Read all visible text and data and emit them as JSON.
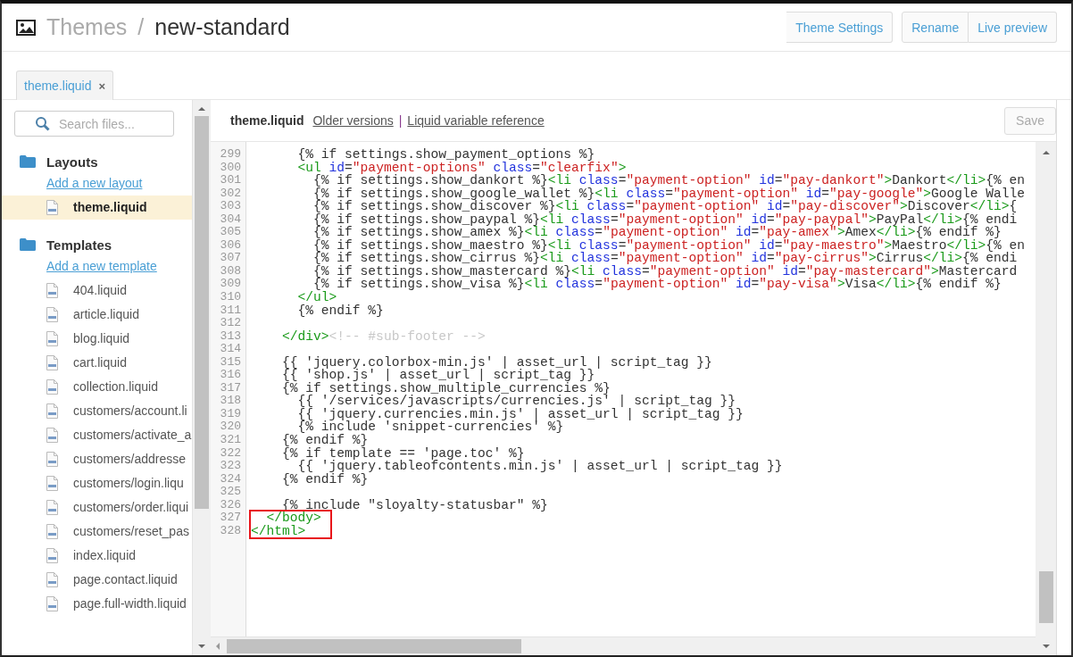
{
  "header": {
    "breadcrumb": "Themes",
    "separator": "/",
    "title": "new-standard",
    "button_groups": [
      {
        "buttons": [
          "Theme Settings"
        ]
      },
      {
        "buttons": [
          "Rename",
          "Live preview"
        ]
      }
    ]
  },
  "tabs": [
    {
      "label": "theme.liquid",
      "close": "×",
      "selected": true
    }
  ],
  "sidebar": {
    "search": {
      "placeholder": "Search files..."
    },
    "sections": [
      {
        "title": "Layouts",
        "add_link": "Add a new layout",
        "items": [
          {
            "label": "theme.liquid",
            "selected": true
          }
        ]
      },
      {
        "title": "Templates",
        "add_link": "Add a new template",
        "items": [
          {
            "label": "404.liquid",
            "selected": false
          },
          {
            "label": "article.liquid",
            "selected": false
          },
          {
            "label": "blog.liquid",
            "selected": false
          },
          {
            "label": "cart.liquid",
            "selected": false
          },
          {
            "label": "collection.liquid",
            "selected": false
          },
          {
            "label": "customers/account.li",
            "selected": false
          },
          {
            "label": "customers/activate_a",
            "selected": false
          },
          {
            "label": "customers/addresse",
            "selected": false
          },
          {
            "label": "customers/login.liqu",
            "selected": false
          },
          {
            "label": "customers/order.liqui",
            "selected": false
          },
          {
            "label": "customers/reset_pas",
            "selected": false
          },
          {
            "label": "index.liquid",
            "selected": false
          },
          {
            "label": "page.contact.liquid",
            "selected": false
          },
          {
            "label": "page.full-width.liquid",
            "selected": false
          }
        ]
      }
    ]
  },
  "editor": {
    "filename": "theme.liquid",
    "links": [
      "Older versions",
      "Liquid variable reference"
    ],
    "link_separator": "|",
    "save": {
      "label": "Save",
      "disabled": true
    },
    "lines": [
      {
        "number": "299",
        "highlighted": false,
        "tokens": [
          {
            "kind": "plain",
            "text": "      {% if settings.show_payment_options %}"
          }
        ]
      },
      {
        "number": "300",
        "highlighted": false,
        "tokens": [
          {
            "kind": "tag",
            "text": "      <ul "
          },
          {
            "kind": "attr",
            "text": "id"
          },
          {
            "kind": "plain",
            "text": "="
          },
          {
            "kind": "string",
            "text": "\"payment-options\" "
          },
          {
            "kind": "attr",
            "text": "class"
          },
          {
            "kind": "plain",
            "text": "="
          },
          {
            "kind": "string",
            "text": "\"clearfix\""
          },
          {
            "kind": "tag",
            "text": ">"
          }
        ]
      },
      {
        "number": "301",
        "highlighted": false,
        "tokens": [
          {
            "kind": "plain",
            "text": "        {% if settings.show_dankort %}"
          },
          {
            "kind": "tag",
            "text": "<li "
          },
          {
            "kind": "attr",
            "text": "class"
          },
          {
            "kind": "plain",
            "text": "="
          },
          {
            "kind": "string",
            "text": "\"payment-option\" "
          },
          {
            "kind": "attr",
            "text": "id"
          },
          {
            "kind": "plain",
            "text": "="
          },
          {
            "kind": "string",
            "text": "\"pay-dankort\""
          },
          {
            "kind": "tag",
            "text": ">"
          },
          {
            "kind": "plain",
            "text": "Dankort"
          },
          {
            "kind": "tag",
            "text": "</li>"
          },
          {
            "kind": "plain",
            "text": "{% en"
          }
        ]
      },
      {
        "number": "302",
        "highlighted": false,
        "tokens": [
          {
            "kind": "plain",
            "text": "        {% if settings.show_google_wallet %}"
          },
          {
            "kind": "tag",
            "text": "<li "
          },
          {
            "kind": "attr",
            "text": "class"
          },
          {
            "kind": "plain",
            "text": "="
          },
          {
            "kind": "string",
            "text": "\"payment-option\" "
          },
          {
            "kind": "attr",
            "text": "id"
          },
          {
            "kind": "plain",
            "text": "="
          },
          {
            "kind": "string",
            "text": "\"pay-google\""
          },
          {
            "kind": "tag",
            "text": ">"
          },
          {
            "kind": "plain",
            "text": "Google Walle"
          }
        ]
      },
      {
        "number": "303",
        "highlighted": false,
        "tokens": [
          {
            "kind": "plain",
            "text": "        {% if settings.show_discover %}"
          },
          {
            "kind": "tag",
            "text": "<li "
          },
          {
            "kind": "attr",
            "text": "class"
          },
          {
            "kind": "plain",
            "text": "="
          },
          {
            "kind": "string",
            "text": "\"payment-option\" "
          },
          {
            "kind": "attr",
            "text": "id"
          },
          {
            "kind": "plain",
            "text": "="
          },
          {
            "kind": "string",
            "text": "\"pay-discover\""
          },
          {
            "kind": "tag",
            "text": ">"
          },
          {
            "kind": "plain",
            "text": "Discover"
          },
          {
            "kind": "tag",
            "text": "</li>"
          },
          {
            "kind": "plain",
            "text": "{"
          }
        ]
      },
      {
        "number": "304",
        "highlighted": false,
        "tokens": [
          {
            "kind": "plain",
            "text": "        {% if settings.show_paypal %}"
          },
          {
            "kind": "tag",
            "text": "<li "
          },
          {
            "kind": "attr",
            "text": "class"
          },
          {
            "kind": "plain",
            "text": "="
          },
          {
            "kind": "string",
            "text": "\"payment-option\" "
          },
          {
            "kind": "attr",
            "text": "id"
          },
          {
            "kind": "plain",
            "text": "="
          },
          {
            "kind": "string",
            "text": "\"pay-paypal\""
          },
          {
            "kind": "tag",
            "text": ">"
          },
          {
            "kind": "plain",
            "text": "PayPal"
          },
          {
            "kind": "tag",
            "text": "</li>"
          },
          {
            "kind": "plain",
            "text": "{% endi"
          }
        ]
      },
      {
        "number": "305",
        "highlighted": false,
        "tokens": [
          {
            "kind": "plain",
            "text": "        {% if settings.show_amex %}"
          },
          {
            "kind": "tag",
            "text": "<li "
          },
          {
            "kind": "attr",
            "text": "class"
          },
          {
            "kind": "plain",
            "text": "="
          },
          {
            "kind": "string",
            "text": "\"payment-option\" "
          },
          {
            "kind": "attr",
            "text": "id"
          },
          {
            "kind": "plain",
            "text": "="
          },
          {
            "kind": "string",
            "text": "\"pay-amex\""
          },
          {
            "kind": "tag",
            "text": ">"
          },
          {
            "kind": "plain",
            "text": "Amex"
          },
          {
            "kind": "tag",
            "text": "</li>"
          },
          {
            "kind": "plain",
            "text": "{% endif %}"
          }
        ]
      },
      {
        "number": "306",
        "highlighted": false,
        "tokens": [
          {
            "kind": "plain",
            "text": "        {% if settings.show_maestro %}"
          },
          {
            "kind": "tag",
            "text": "<li "
          },
          {
            "kind": "attr",
            "text": "class"
          },
          {
            "kind": "plain",
            "text": "="
          },
          {
            "kind": "string",
            "text": "\"payment-option\" "
          },
          {
            "kind": "attr",
            "text": "id"
          },
          {
            "kind": "plain",
            "text": "="
          },
          {
            "kind": "string",
            "text": "\"pay-maestro\""
          },
          {
            "kind": "tag",
            "text": ">"
          },
          {
            "kind": "plain",
            "text": "Maestro"
          },
          {
            "kind": "tag",
            "text": "</li>"
          },
          {
            "kind": "plain",
            "text": "{% en"
          }
        ]
      },
      {
        "number": "307",
        "highlighted": false,
        "tokens": [
          {
            "kind": "plain",
            "text": "        {% if settings.show_cirrus %}"
          },
          {
            "kind": "tag",
            "text": "<li "
          },
          {
            "kind": "attr",
            "text": "class"
          },
          {
            "kind": "plain",
            "text": "="
          },
          {
            "kind": "string",
            "text": "\"payment-option\" "
          },
          {
            "kind": "attr",
            "text": "id"
          },
          {
            "kind": "plain",
            "text": "="
          },
          {
            "kind": "string",
            "text": "\"pay-cirrus\""
          },
          {
            "kind": "tag",
            "text": ">"
          },
          {
            "kind": "plain",
            "text": "Cirrus"
          },
          {
            "kind": "tag",
            "text": "</li>"
          },
          {
            "kind": "plain",
            "text": "{% endi"
          }
        ]
      },
      {
        "number": "308",
        "highlighted": false,
        "tokens": [
          {
            "kind": "plain",
            "text": "        {% if settings.show_mastercard %}"
          },
          {
            "kind": "tag",
            "text": "<li "
          },
          {
            "kind": "attr",
            "text": "class"
          },
          {
            "kind": "plain",
            "text": "="
          },
          {
            "kind": "string",
            "text": "\"payment-option\" "
          },
          {
            "kind": "attr",
            "text": "id"
          },
          {
            "kind": "plain",
            "text": "="
          },
          {
            "kind": "string",
            "text": "\"pay-mastercard\""
          },
          {
            "kind": "tag",
            "text": ">"
          },
          {
            "kind": "plain",
            "text": "Mastercard"
          }
        ]
      },
      {
        "number": "309",
        "highlighted": false,
        "tokens": [
          {
            "kind": "plain",
            "text": "        {% if settings.show_visa %}"
          },
          {
            "kind": "tag",
            "text": "<li "
          },
          {
            "kind": "attr",
            "text": "class"
          },
          {
            "kind": "plain",
            "text": "="
          },
          {
            "kind": "string",
            "text": "\"payment-option\" "
          },
          {
            "kind": "attr",
            "text": "id"
          },
          {
            "kind": "plain",
            "text": "="
          },
          {
            "kind": "string",
            "text": "\"pay-visa\""
          },
          {
            "kind": "tag",
            "text": ">"
          },
          {
            "kind": "plain",
            "text": "Visa"
          },
          {
            "kind": "tag",
            "text": "</li>"
          },
          {
            "kind": "plain",
            "text": "{% endif %}"
          }
        ]
      },
      {
        "number": "310",
        "highlighted": false,
        "tokens": [
          {
            "kind": "tag",
            "text": "      </ul>"
          }
        ]
      },
      {
        "number": "311",
        "highlighted": false,
        "tokens": [
          {
            "kind": "plain",
            "text": "      {% endif %}"
          }
        ]
      },
      {
        "number": "312",
        "highlighted": false
      },
      {
        "number": "313",
        "highlighted": false,
        "tokens": [
          {
            "kind": "tag",
            "text": "    </div>"
          },
          {
            "kind": "comment",
            "text": "<!-- #sub-footer -->"
          }
        ]
      },
      {
        "number": "314",
        "highlighted": false
      },
      {
        "number": "315",
        "highlighted": false,
        "tokens": [
          {
            "kind": "plain",
            "text": "    {{ 'jquery.colorbox-min.js' | asset_url | script_tag }}"
          }
        ]
      },
      {
        "number": "316",
        "highlighted": false,
        "tokens": [
          {
            "kind": "plain",
            "text": "    {{ 'shop.js' | asset_url | script_tag }}"
          }
        ]
      },
      {
        "number": "317",
        "highlighted": false,
        "tokens": [
          {
            "kind": "plain",
            "text": "    {% if settings.show_multiple_currencies %}"
          }
        ]
      },
      {
        "number": "318",
        "highlighted": false,
        "tokens": [
          {
            "kind": "plain",
            "text": "      {{ '/services/javascripts/currencies.js' | script_tag }}"
          }
        ]
      },
      {
        "number": "319",
        "highlighted": false,
        "tokens": [
          {
            "kind": "plain",
            "text": "      {{ 'jquery.currencies.min.js' | asset_url | script_tag }}"
          }
        ]
      },
      {
        "number": "320",
        "highlighted": false,
        "tokens": [
          {
            "kind": "plain",
            "text": "      {% include 'snippet-currencies' %}"
          }
        ]
      },
      {
        "number": "321",
        "highlighted": false,
        "tokens": [
          {
            "kind": "plain",
            "text": "    {% endif %}"
          }
        ]
      },
      {
        "number": "322",
        "highlighted": false,
        "tokens": [
          {
            "kind": "plain",
            "text": "    {% if template == 'page.toc' %}"
          }
        ]
      },
      {
        "number": "323",
        "highlighted": false,
        "tokens": [
          {
            "kind": "plain",
            "text": "      {{ 'jquery.tableofcontents.min.js' | asset_url | script_tag }}"
          }
        ]
      },
      {
        "number": "324",
        "highlighted": false,
        "tokens": [
          {
            "kind": "plain",
            "text": "    {% endif %}"
          }
        ]
      },
      {
        "number": "325",
        "highlighted": false
      },
      {
        "number": "326",
        "highlighted": false,
        "tokens": [
          {
            "kind": "plain",
            "text": "    {% include \"sloyalty-statusbar\" %}"
          }
        ]
      },
      {
        "number": "327",
        "highlighted": true,
        "tokens": [
          {
            "kind": "tag",
            "text": "  </body>"
          }
        ]
      },
      {
        "number": "328",
        "highlighted": true,
        "tokens": [
          {
            "kind": "tag",
            "text": "</html>"
          }
        ]
      }
    ]
  }
}
